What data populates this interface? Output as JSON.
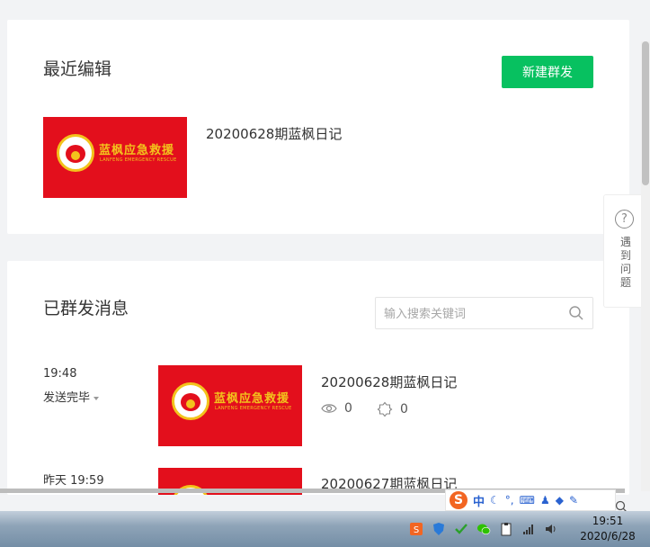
{
  "recent": {
    "title": "最近编辑",
    "new_button_label": "新建群发",
    "item": {
      "title": "20200628期蓝枫日记"
    }
  },
  "cover": {
    "brand_cn": "蓝枫应急救援",
    "brand_en": "LANFENG EMERGENCY RESCUE"
  },
  "sent": {
    "title": "已群发消息",
    "search": {
      "placeholder": "输入搜索关键词",
      "value": ""
    },
    "items": [
      {
        "time": "19:48",
        "status": "发送完毕",
        "title": "20200628期蓝枫日记",
        "views": "0",
        "likes": "0"
      },
      {
        "time": "昨天 19:59",
        "title": "20200627期蓝枫日记"
      }
    ]
  },
  "help": {
    "label": "遇到问题",
    "icon": "?"
  },
  "ime": {
    "logo": "S",
    "lang": "中"
  },
  "taskbar": {
    "time": "19:51",
    "date": "2020/6/28"
  },
  "colors": {
    "primary": "#07c160",
    "cover_red": "#e30f1c",
    "cover_gold": "#f3c31c"
  },
  "icons": [
    "search-icon",
    "eye-icon",
    "like-icon",
    "help-icon",
    "sogou-icon",
    "shield-icon",
    "wechat-icon",
    "network-icon",
    "volume-icon"
  ]
}
